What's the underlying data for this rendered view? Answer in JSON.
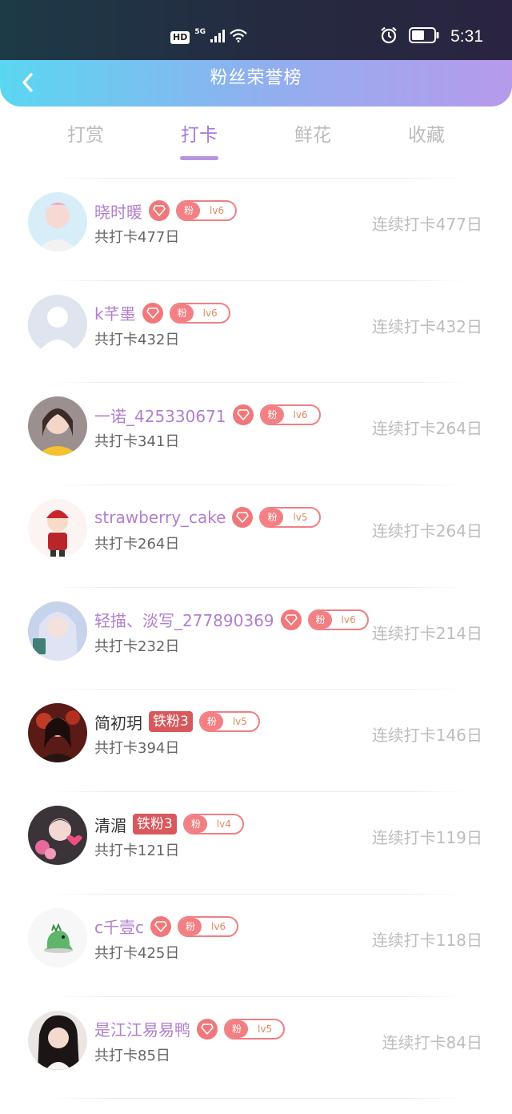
{
  "status_bar": {
    "hd": "HD",
    "network": "5G",
    "time": "5:31"
  },
  "header": {
    "title": "粉丝荣誉榜"
  },
  "tabs": [
    {
      "label": "打赏"
    },
    {
      "label": "打卡"
    },
    {
      "label": "鲜花"
    },
    {
      "label": "收藏"
    }
  ],
  "active_tab": "打卡",
  "fans": [
    {
      "name": "晓时暖",
      "badge_text": "",
      "fan_tag": "粉",
      "level": "lv6",
      "total": "共打卡477日",
      "streak": "连续打卡477日"
    },
    {
      "name": "k芊墨",
      "badge_text": "",
      "fan_tag": "粉",
      "level": "lv6",
      "total": "共打卡432日",
      "streak": "连续打卡432日"
    },
    {
      "name": "一诺_425330671",
      "badge_text": "",
      "fan_tag": "粉",
      "level": "lv6",
      "total": "共打卡341日",
      "streak": "连续打卡264日"
    },
    {
      "name": "strawberry_cake",
      "badge_text": "",
      "fan_tag": "粉",
      "level": "lv5",
      "total": "共打卡264日",
      "streak": "连续打卡264日"
    },
    {
      "name": "轻描、淡写_277890369",
      "badge_text": "",
      "fan_tag": "粉",
      "level": "lv6",
      "total": "共打卡232日",
      "streak": "连续打卡214日"
    },
    {
      "name": "简初玥",
      "badge_text": "铁粉3",
      "fan_tag": "粉",
      "level": "lv5",
      "total": "共打卡394日",
      "streak": "连续打卡146日"
    },
    {
      "name": "清湄",
      "badge_text": "铁粉3",
      "fan_tag": "粉",
      "level": "lv4",
      "total": "共打卡121日",
      "streak": "连续打卡119日"
    },
    {
      "name": "c千壹c",
      "badge_text": "",
      "fan_tag": "粉",
      "level": "lv6",
      "total": "共打卡425日",
      "streak": "连续打卡118日"
    },
    {
      "name": "是江江易易鸭",
      "badge_text": "",
      "fan_tag": "粉",
      "level": "lv5",
      "total": "共打卡85日",
      "streak": "连续打卡84日"
    }
  ],
  "colors": {
    "accent": "#a77cd6",
    "name_purple": "#b27fce",
    "badge_red": "#f0787b",
    "muted": "#bdbdbd"
  }
}
